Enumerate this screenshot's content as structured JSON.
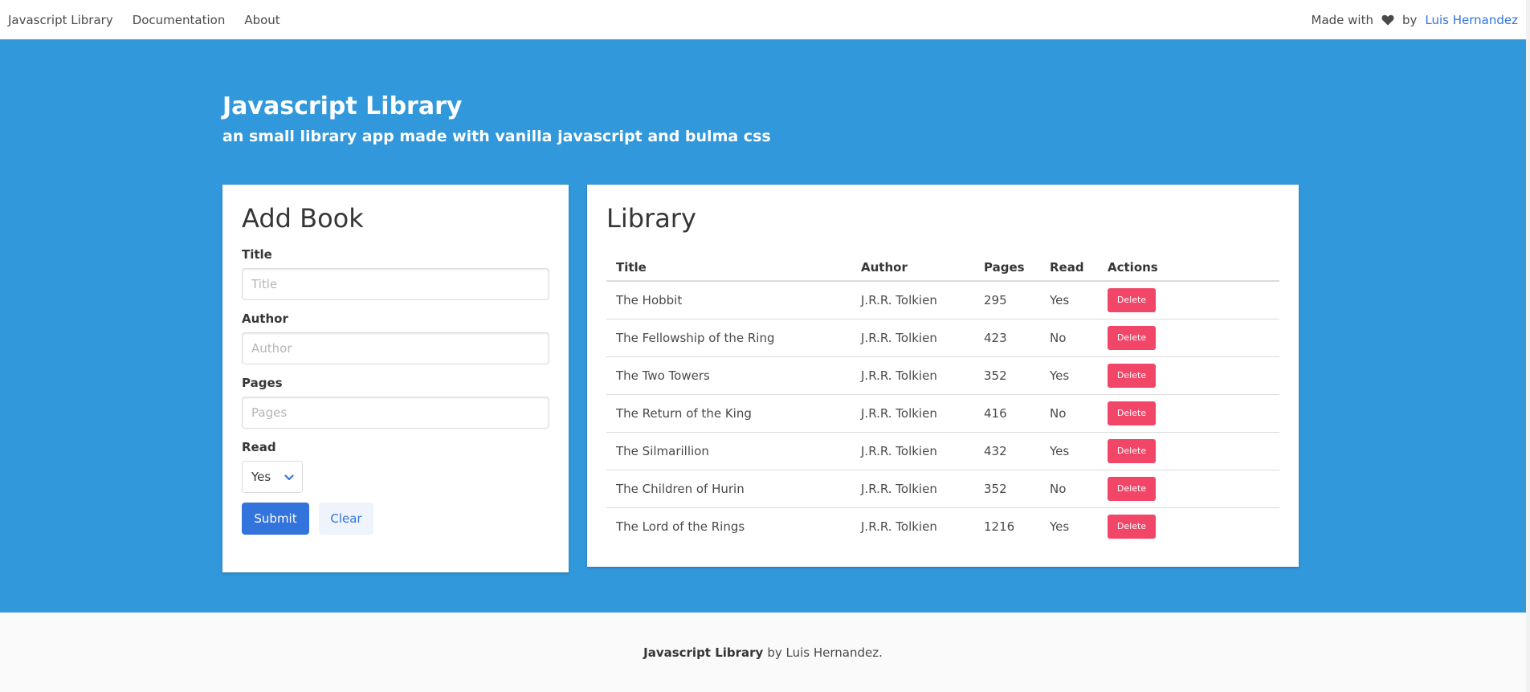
{
  "navbar": {
    "brand": "Javascript Library",
    "items": [
      {
        "label": "Documentation"
      },
      {
        "label": "About"
      }
    ],
    "made_with": "Made with",
    "by": "by",
    "author_link": "Luis Hernandez",
    "heart_icon": "heart-icon"
  },
  "hero": {
    "title": "Javascript Library",
    "subtitle": "an small library app made with vanilla javascript and bulma css"
  },
  "form": {
    "title": "Add Book",
    "fields": {
      "title": {
        "label": "Title",
        "placeholder": "Title",
        "value": ""
      },
      "author": {
        "label": "Author",
        "placeholder": "Author",
        "value": ""
      },
      "pages": {
        "label": "Pages",
        "placeholder": "Pages",
        "value": ""
      },
      "read": {
        "label": "Read",
        "selected": "Yes",
        "icon": "chevron-down-icon"
      }
    },
    "submit_label": "Submit",
    "clear_label": "Clear"
  },
  "library": {
    "title": "Library",
    "columns": [
      "Title",
      "Author",
      "Pages",
      "Read",
      "Actions"
    ],
    "delete_label": "Delete",
    "books": [
      {
        "title": "The Hobbit",
        "author": "J.R.R. Tolkien",
        "pages": "295",
        "read": "Yes"
      },
      {
        "title": "The Fellowship of the Ring",
        "author": "J.R.R. Tolkien",
        "pages": "423",
        "read": "No"
      },
      {
        "title": "The Two Towers",
        "author": "J.R.R. Tolkien",
        "pages": "352",
        "read": "Yes"
      },
      {
        "title": "The Return of the King",
        "author": "J.R.R. Tolkien",
        "pages": "416",
        "read": "No"
      },
      {
        "title": "The Silmarillion",
        "author": "J.R.R. Tolkien",
        "pages": "432",
        "read": "Yes"
      },
      {
        "title": "The Children of Hurin",
        "author": "J.R.R. Tolkien",
        "pages": "352",
        "read": "No"
      },
      {
        "title": "The Lord of the Rings",
        "author": "J.R.R. Tolkien",
        "pages": "1216",
        "read": "Yes"
      }
    ]
  },
  "footer": {
    "brand": "Javascript Library",
    "byline": "by Luis Hernandez."
  },
  "colors": {
    "hero_background": "#3298dc",
    "primary": "#3273dc",
    "danger": "#f14668",
    "footer_background": "#fafafa"
  }
}
